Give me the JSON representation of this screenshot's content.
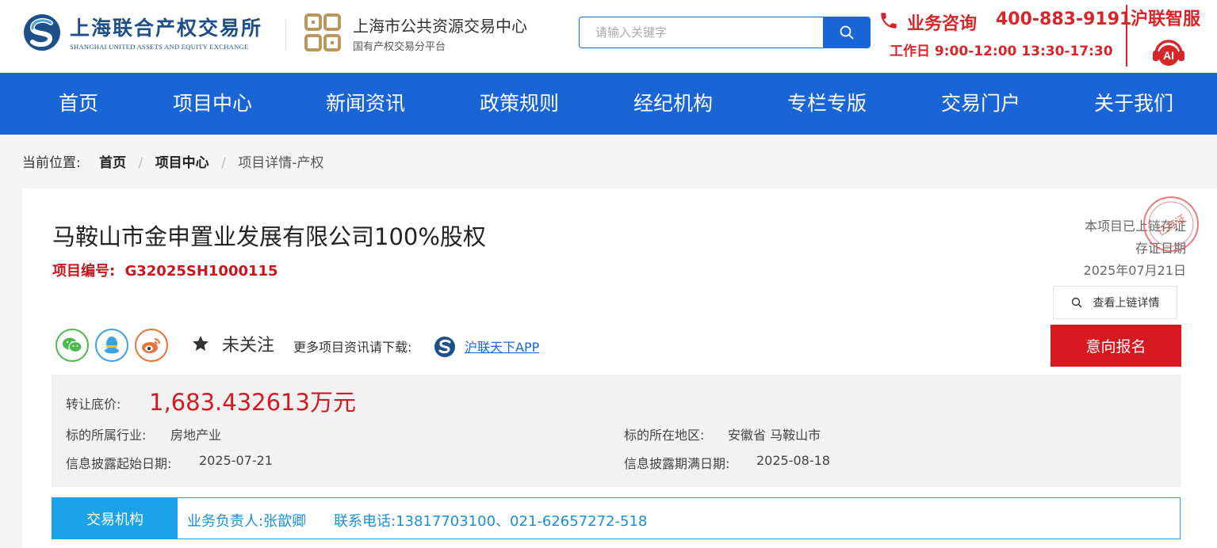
{
  "header": {
    "logo_cn": "上海联合产权交易所",
    "logo_en": "SHANGHAI UNITED ASSETS AND EQUITY EXCHANGE",
    "center_name": "上海市公共资源交易中心",
    "center_sub": "国有产权交易分平台",
    "search_placeholder": "请输入关键字",
    "consult_label": "业务咨询",
    "consult_phone": "400-883-9191",
    "work_hours": "工作日  9:00-12:00  13:30-17:30",
    "ai_service": "沪联智服",
    "ai_badge": "AI"
  },
  "nav": {
    "items": [
      "首页",
      "项目中心",
      "新闻资讯",
      "政策规则",
      "经纪机构",
      "专栏专版",
      "交易门户",
      "关于我们"
    ]
  },
  "breadcrumb": {
    "prefix": "当前位置:",
    "home": "首页",
    "project_center": "项目中心",
    "current": "项目详情-产权",
    "separator": "/"
  },
  "project": {
    "title": "马鞍山市金申置业发展有限公司100%股权",
    "code_label": "项目编号:",
    "code": "G32025SH1000115",
    "chain_text": "本项目已上链存证",
    "chain_date_label": "存证日期",
    "chain_date": "2025年07月21日",
    "stamp_text": "已存证",
    "chain_button": "查看上链详情",
    "sign_button": "意向报名",
    "follow_text": "未关注",
    "more_text": "更多项目资讯请下载:",
    "app_link": "沪联天下APP"
  },
  "info": {
    "price_label": "转让底价:",
    "price": "1,683.432613万元",
    "industry_label": "标的所属行业:",
    "industry": "房地产业",
    "region_label": "标的所在地区:",
    "region": "安徽省 马鞍山市",
    "start_label": "信息披露起始日期:",
    "start_date": "2025-07-21",
    "end_label": "信息披露期满日期:",
    "end_date": "2025-08-18"
  },
  "contact": {
    "tab": "交易机构",
    "person": "业务负责人:张歆卿",
    "phone": "联系电话:13817703100、021-62657272-518"
  },
  "colors": {
    "brand_blue": "#1a65d6",
    "accent_red": "#d6191f",
    "contact_blue": "#1aa3e8"
  }
}
